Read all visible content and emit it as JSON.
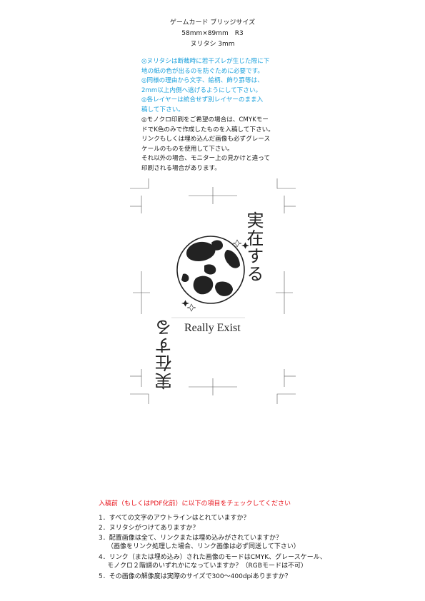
{
  "header": {
    "line1": "ゲームカード ブリッジサイズ",
    "line2": "58mm×89mm　R3",
    "line3": "ヌリタシ 3mm"
  },
  "notes_blue": [
    "◎ヌリタシは断裁時に若干ズレが生じた際に下",
    "地の紙の色が出るのを防ぐために必要です。",
    "◎同様の理由から文字、絵柄、飾り罫等は、",
    "2mm以上内側へ逃げるようにして下さい。",
    "◎各レイヤーは統合せず別レイヤーのまま入",
    "稿して下さい。"
  ],
  "notes_black": [
    "◎モノクロ印刷をご希望の場合は、CMYKモー",
    "ドでK色のみで作成したものを入稿して下さい。",
    "リンクもしくは埋め込んだ画像も必ずグレース",
    "ケールのものを使用して下さい。",
    "それ以外の場合、モニター上の見かけと違って",
    "印刷される場合があります。"
  ],
  "card": {
    "title_jp": "実在する",
    "title_jp_rotated": "実在する",
    "title_en": "Really Exist"
  },
  "checklist": {
    "heading": "入稿前（もしくはPDF化前）に以下の項目をチェックしてください",
    "items": [
      "1．すべての文字のアウトラインはとれていますか？",
      "2．ヌリタシがつけてありますか？",
      "3．配置画像は全て、リンクまたは埋め込みがされていますか？",
      "（画像をリンク処理した場合、リンク画像は必ず同送して下さい）",
      "4．リンク（または埋め込み）された画像のモードはCMYK、グレースケール、",
      "モノクロ２階調のいずれかになっていますか？（RGBモードは不可）",
      "5．その画像の解像度は実際のサイズで300～400dpiありますか？"
    ]
  },
  "colors": {
    "note_blue": "#1aa0dc",
    "checklist_heading": "#e8141c"
  }
}
